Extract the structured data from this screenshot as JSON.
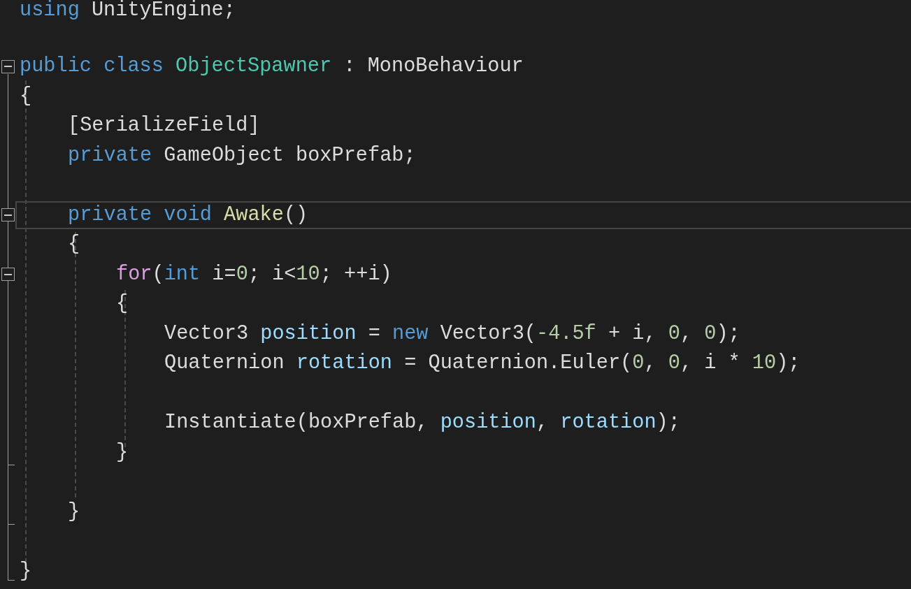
{
  "editor": {
    "lines": [
      {
        "tokens": [
          {
            "text": "using",
            "kind": "keyword"
          },
          {
            "text": " UnityEngine;",
            "kind": "plain"
          }
        ],
        "foldable": false,
        "current": false
      },
      {
        "foldable": false,
        "current": false
      },
      {
        "tokens": [
          {
            "text": "public",
            "kind": "keyword"
          },
          {
            "text": " class",
            "kind": "keyword"
          },
          {
            "text": " ObjectSpawner",
            "kind": "type"
          },
          {
            "text": " : MonoBehaviour",
            "kind": "plain"
          }
        ],
        "foldable": true,
        "current": false
      },
      {
        "tokens": [
          {
            "text": "{",
            "kind": "plain"
          }
        ],
        "foldable": false,
        "current": false,
        "children": [
          {
            "tokens": [
              {
                "text": "[SerializeField]",
                "kind": "plain"
              }
            ],
            "foldable": false,
            "current": false
          },
          {
            "tokens": [
              {
                "text": "private",
                "kind": "keyword"
              },
              {
                "text": " GameObject boxPrefab;",
                "kind": "plain"
              }
            ],
            "foldable": false,
            "current": false
          },
          {
            "foldable": false,
            "current": false
          },
          {
            "tokens": [
              {
                "text": "private",
                "kind": "keyword"
              },
              {
                "text": " void",
                "kind": "keyword"
              },
              {
                "text": " Awake",
                "kind": "method"
              },
              {
                "text": "()",
                "kind": "plain"
              }
            ],
            "foldable": true,
            "current": true
          },
          {
            "tokens": [
              {
                "text": "{",
                "kind": "plain"
              }
            ],
            "foldable": false,
            "current": false,
            "children": [
              {
                "tokens": [
                  {
                    "text": "for",
                    "kind": "control"
                  },
                  {
                    "text": "(",
                    "kind": "plain"
                  },
                  {
                    "text": "int",
                    "kind": "keyword"
                  },
                  {
                    "text": " i=",
                    "kind": "plain"
                  },
                  {
                    "text": "0",
                    "kind": "number"
                  },
                  {
                    "text": "; i<",
                    "kind": "plain"
                  },
                  {
                    "text": "10",
                    "kind": "number"
                  },
                  {
                    "text": "; ++i)",
                    "kind": "plain"
                  }
                ],
                "foldable": true,
                "current": false
              },
              {
                "tokens": [
                  {
                    "text": "{",
                    "kind": "plain"
                  }
                ],
                "foldable": false,
                "current": false,
                "children": [
                  {
                    "tokens": [
                      {
                        "text": "Vector3",
                        "kind": "plain"
                      },
                      {
                        "text": " position",
                        "kind": "param"
                      },
                      {
                        "text": " =",
                        "kind": "plain"
                      },
                      {
                        "text": " new",
                        "kind": "keyword"
                      },
                      {
                        "text": " Vector3(",
                        "kind": "plain"
                      },
                      {
                        "text": "-4.5f",
                        "kind": "number"
                      },
                      {
                        "text": " + i,",
                        "kind": "plain"
                      },
                      {
                        "text": " 0",
                        "kind": "number"
                      },
                      {
                        "text": ",",
                        "kind": "plain"
                      },
                      {
                        "text": " 0",
                        "kind": "number"
                      },
                      {
                        "text": ");",
                        "kind": "plain"
                      }
                    ],
                    "foldable": false,
                    "current": false
                  },
                  {
                    "tokens": [
                      {
                        "text": "Quaternion",
                        "kind": "plain"
                      },
                      {
                        "text": " rotation",
                        "kind": "param"
                      },
                      {
                        "text": " = Quaternion.Euler(",
                        "kind": "plain"
                      },
                      {
                        "text": "0",
                        "kind": "number"
                      },
                      {
                        "text": ",",
                        "kind": "plain"
                      },
                      {
                        "text": " 0",
                        "kind": "number"
                      },
                      {
                        "text": ", i *",
                        "kind": "plain"
                      },
                      {
                        "text": " 10",
                        "kind": "number"
                      },
                      {
                        "text": ");",
                        "kind": "plain"
                      }
                    ],
                    "foldable": false,
                    "current": false
                  },
                  {
                    "foldable": false,
                    "current": false
                  },
                  {
                    "tokens": [
                      {
                        "text": "Instantiate(boxPrefab,",
                        "kind": "plain"
                      },
                      {
                        "text": " position",
                        "kind": "param"
                      },
                      {
                        "text": ",",
                        "kind": "plain"
                      },
                      {
                        "text": " rotation",
                        "kind": "param"
                      },
                      {
                        "text": ");",
                        "kind": "plain"
                      }
                    ],
                    "foldable": false,
                    "current": false
                  }
                ]
              },
              {
                "tokens": [
                  {
                    "text": "}",
                    "kind": "plain"
                  }
                ],
                "foldable": false,
                "current": false
              },
              {
                "foldable": false,
                "current": false
              }
            ]
          },
          {
            "tokens": [
              {
                "text": "}",
                "kind": "plain"
              }
            ],
            "foldable": false,
            "current": false
          },
          {
            "foldable": false,
            "current": false
          }
        ]
      },
      {
        "tokens": [
          {
            "text": "}",
            "kind": "plain"
          }
        ],
        "foldable": false,
        "current": false
      }
    ]
  }
}
